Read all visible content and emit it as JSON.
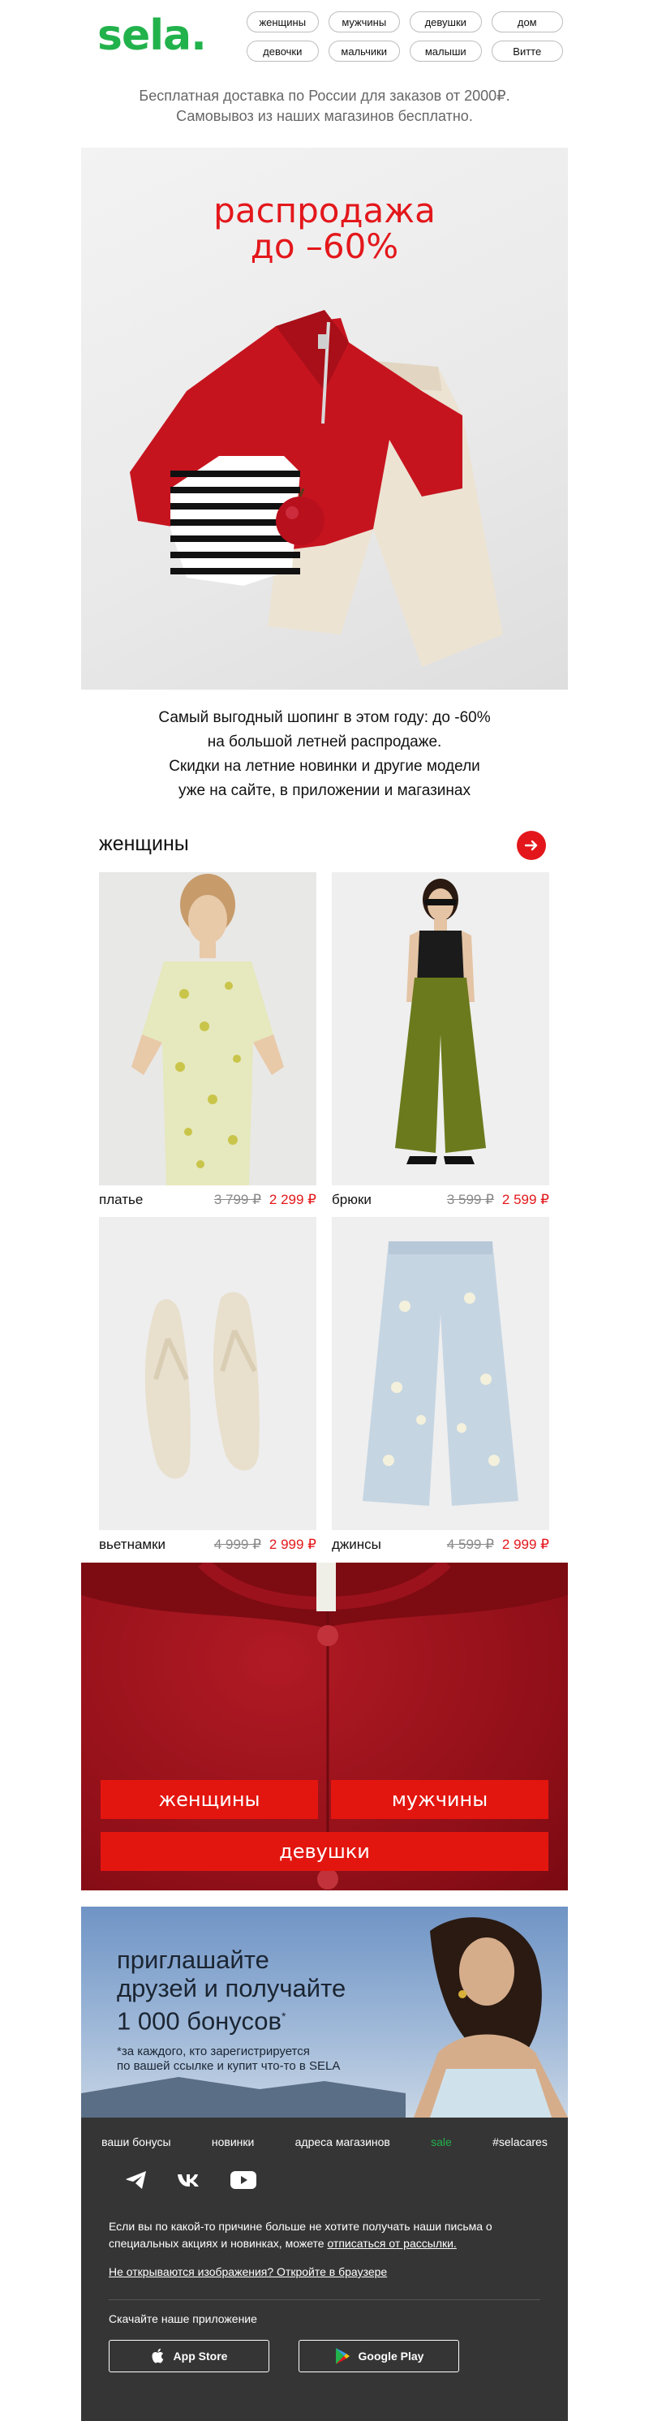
{
  "header": {
    "logo": "sela.",
    "nav": [
      "женщины",
      "мужчины",
      "девушки",
      "дом",
      "девочки",
      "мальчики",
      "малыши",
      "Витте"
    ]
  },
  "delivery": {
    "line1": "Бесплатная доставка по России для заказов от 2000₽.",
    "line2": "Самовывоз из наших магазинов бесплатно."
  },
  "hero": {
    "title_line1": "распродажа",
    "title_line2": "до –60%"
  },
  "intro": {
    "lines": [
      "Самый выгодный шопинг в этом году: до -60%",
      "на большой летней распродаже.",
      "Скидки на летние новинки и другие модели",
      "уже на сайте, в приложении и магазинах"
    ]
  },
  "women_section": {
    "title": "женщины",
    "products": [
      {
        "name": "платье",
        "old_price": "3 799 ₽",
        "new_price": "2 299 ₽"
      },
      {
        "name": "брюки",
        "old_price": "3 599 ₽",
        "new_price": "2 599 ₽"
      },
      {
        "name": "вьетнамки",
        "old_price": "4 999 ₽",
        "new_price": "2 999 ₽"
      },
      {
        "name": "джинсы",
        "old_price": "4 599 ₽",
        "new_price": "2 999 ₽"
      }
    ]
  },
  "categories": {
    "women": "женщины",
    "men": "мужчины",
    "girls": "девушки"
  },
  "referral": {
    "line1": "приглашайте",
    "line2": "друзей и получайте",
    "line3": "1 000 бонусов",
    "mark": "*",
    "note_line1": "*за каждого, кто зарегистрируется",
    "note_line2": "по вашей ссылке и купит что-то в SELA"
  },
  "footer": {
    "links": [
      "ваши бонусы",
      "новинки",
      "адреса магазинов",
      "sale",
      "#selacares"
    ],
    "socials": [
      "telegram-icon",
      "vk-icon",
      "youtube-icon"
    ],
    "unsub_text": "Если вы по какой-то причине больше не хотите получать наши письма о специальных акциях и новинках, можете ",
    "unsub_link": "отписаться от рассылки.",
    "browser_link": "Не открываются изображения? Откройте в браузере",
    "app_label": "Скачайте наше приложение",
    "app_store": "App Store",
    "google_play": "Google Play"
  },
  "colors": {
    "brand_green": "#22b24c",
    "accent_red": "#e3171b",
    "footer_bg": "#353535"
  }
}
